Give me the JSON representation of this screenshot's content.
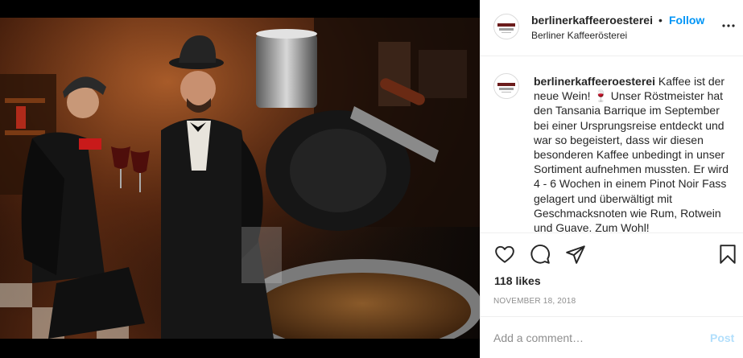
{
  "header": {
    "username": "berlinerkaffeeroesterei",
    "separator": "•",
    "follow_label": "Follow",
    "subtitle": "Berliner Kaffeerösterei",
    "more_icon": "more-options-icon"
  },
  "caption": {
    "username": "berlinerkaffeeroesterei",
    "text": "Kaffee ist der neue Wein! 🍷 Unser Röstmeister hat den Tansania Barrique im September bei einer Ursprungsreise entdeckt und war so begeistert, dass wir diesen besonderen Kaffee unbedingt in unser Sortiment aufnehmen mussten. Er wird 4 - 6 Wochen in einem Pinot Noir Fass gelagert und überwältigt mit Geschmacksnoten wie Rum, Rotwein und Guave. Zum Wohl!"
  },
  "actions": {
    "like_icon": "heart-icon",
    "comment_icon": "comment-icon",
    "share_icon": "share-icon",
    "save_icon": "bookmark-icon"
  },
  "likes": "118 likes",
  "date": "NOVEMBER 18, 2018",
  "comment_box": {
    "placeholder": "Add a comment…",
    "post_label": "Post"
  },
  "colors": {
    "accent": "#0095f6",
    "post_disabled": "#b2dffc",
    "muted": "#8e8e8e"
  }
}
